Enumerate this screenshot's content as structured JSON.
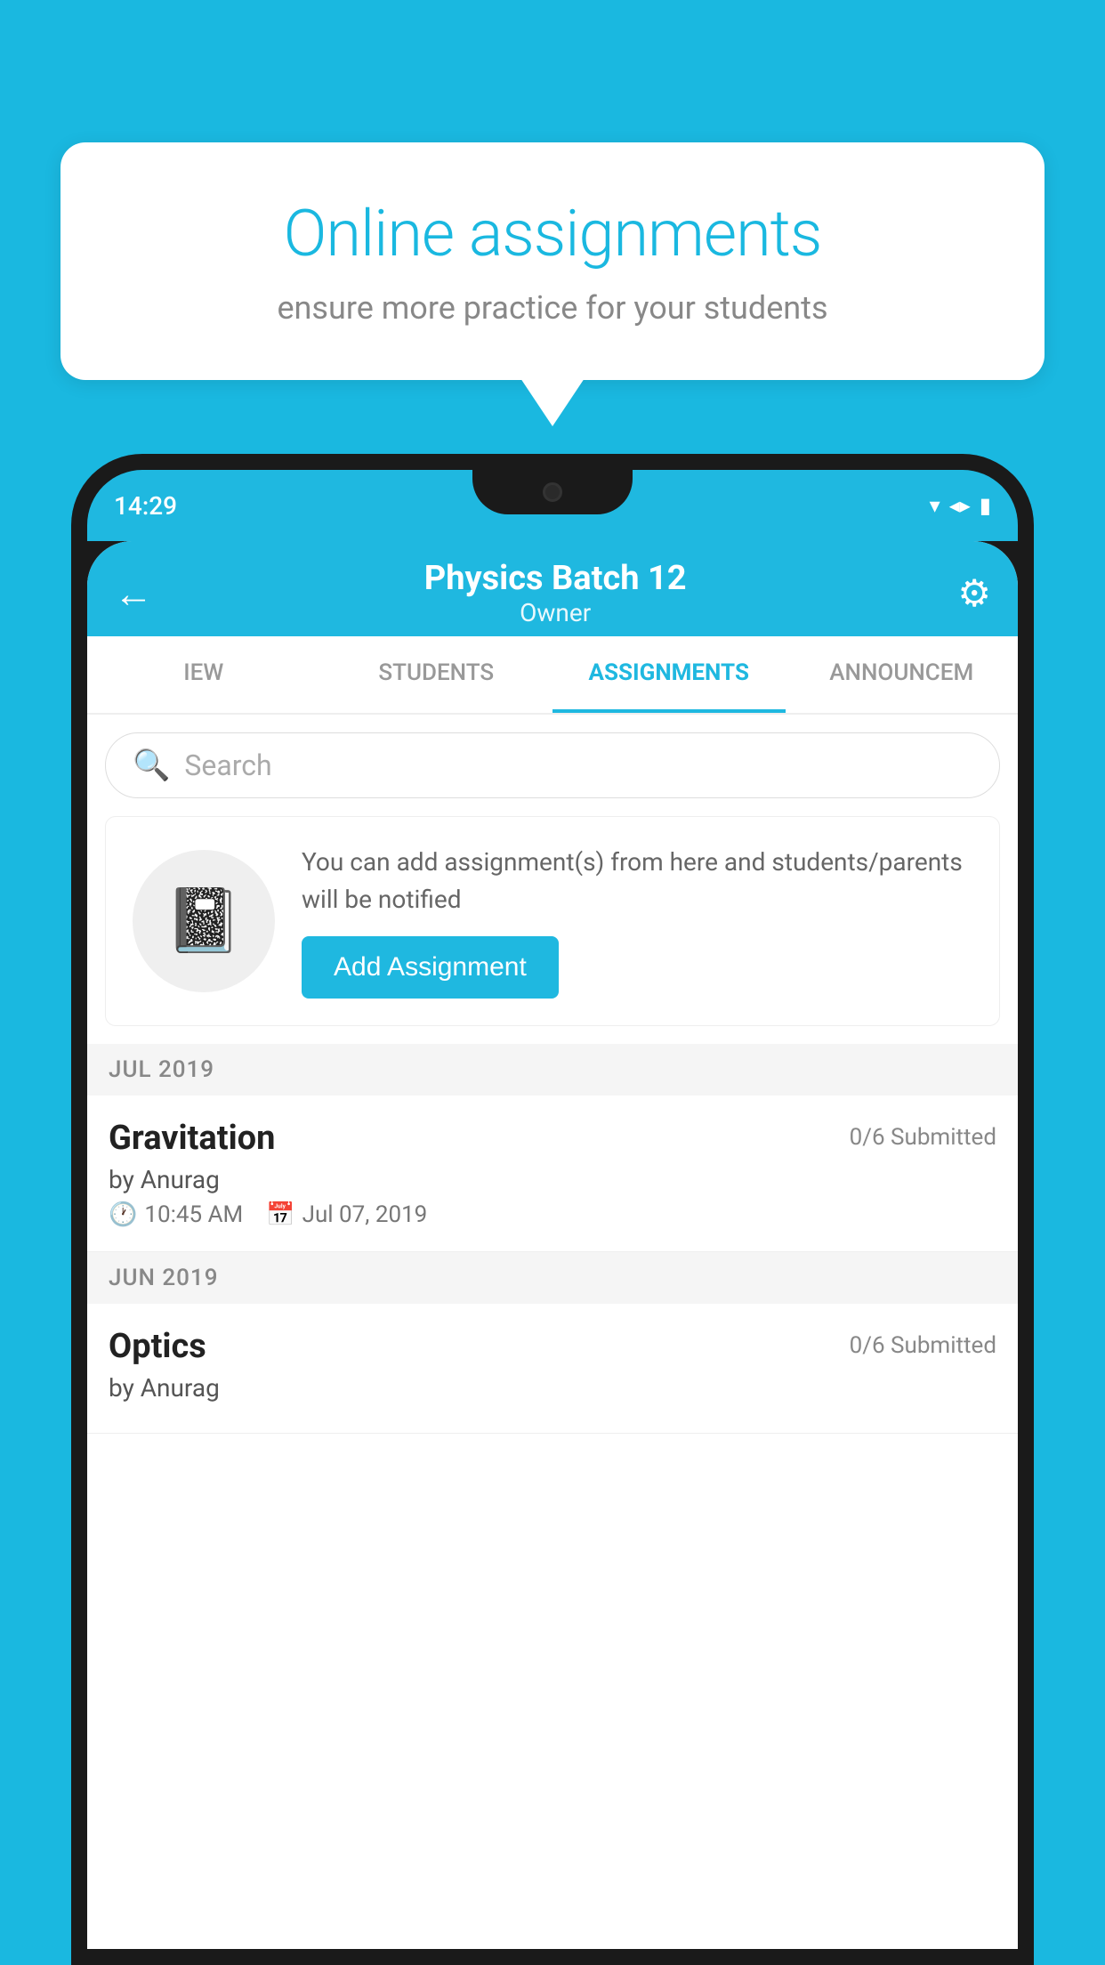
{
  "background_color": "#1ab8e0",
  "speech_bubble": {
    "title": "Online assignments",
    "subtitle": "ensure more practice for your students"
  },
  "phone": {
    "status_bar": {
      "time": "14:29",
      "icons": [
        "wifi",
        "signal",
        "battery"
      ]
    },
    "header": {
      "title": "Physics Batch 12",
      "subtitle": "Owner",
      "back_label": "←",
      "gear_label": "⚙"
    },
    "tabs": [
      {
        "label": "IEW",
        "active": false
      },
      {
        "label": "STUDENTS",
        "active": false
      },
      {
        "label": "ASSIGNMENTS",
        "active": true
      },
      {
        "label": "ANNOUNCEM",
        "active": false
      }
    ],
    "search": {
      "placeholder": "Search"
    },
    "prompt_card": {
      "text": "You can add assignment(s) from here and students/parents will be notified",
      "button_label": "Add Assignment"
    },
    "sections": [
      {
        "month": "JUL 2019",
        "assignments": [
          {
            "name": "Gravitation",
            "submitted": "0/6 Submitted",
            "author": "by Anurag",
            "time": "10:45 AM",
            "date": "Jul 07, 2019"
          }
        ]
      },
      {
        "month": "JUN 2019",
        "assignments": [
          {
            "name": "Optics",
            "submitted": "0/6 Submitted",
            "author": "by Anurag",
            "time": "",
            "date": ""
          }
        ]
      }
    ]
  }
}
